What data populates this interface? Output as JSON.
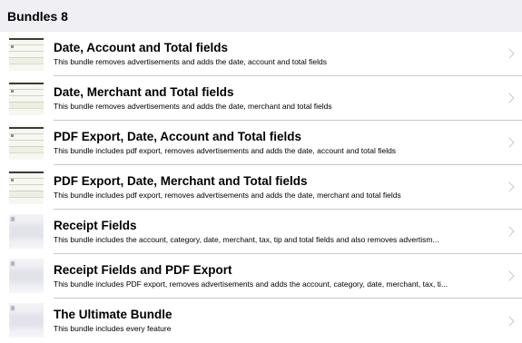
{
  "header": {
    "title": "Bundles 8"
  },
  "bundles": [
    {
      "title": "Date, Account and Total fields",
      "description": "This bundle removes advertisements and adds the date, account and total fields",
      "thumbnail": "table-thumbnail"
    },
    {
      "title": "Date, Merchant and Total fields",
      "description": "This bundle removes advertisements and adds the date, merchant and total fields",
      "thumbnail": "table-thumbnail"
    },
    {
      "title": "PDF Export, Date, Account and Total fields",
      "description": "This bundle includes pdf export, removes advertisements and adds the date, account and total fields",
      "thumbnail": "table-thumbnail"
    },
    {
      "title": "PDF Export, Date, Merchant and Total fields",
      "description": "This bundle includes pdf export, removes advertisements and adds the date, merchant and total fields",
      "thumbnail": "table-thumbnail"
    },
    {
      "title": "Receipt Fields",
      "description": "This bundle includes the account, category, date, merchant, tax, tip and total fields and also removes advertism...",
      "thumbnail": "receipt-thumbnail"
    },
    {
      "title": "Receipt Fields and PDF Export",
      "description": "This bundle includes PDF export, removes advertisements and adds the account, category, date, merchant, tax, ti...",
      "thumbnail": "receipt-thumbnail"
    },
    {
      "title": "The Ultimate Bundle",
      "description": "This bundle includes every feature",
      "thumbnail": "receipt-thumbnail"
    }
  ],
  "icons": {
    "chevron": "chevron-right-icon"
  },
  "colors": {
    "header_bg": "#efeff4",
    "separator": "#c8c7cc",
    "chevron": "#c7c7cc"
  }
}
